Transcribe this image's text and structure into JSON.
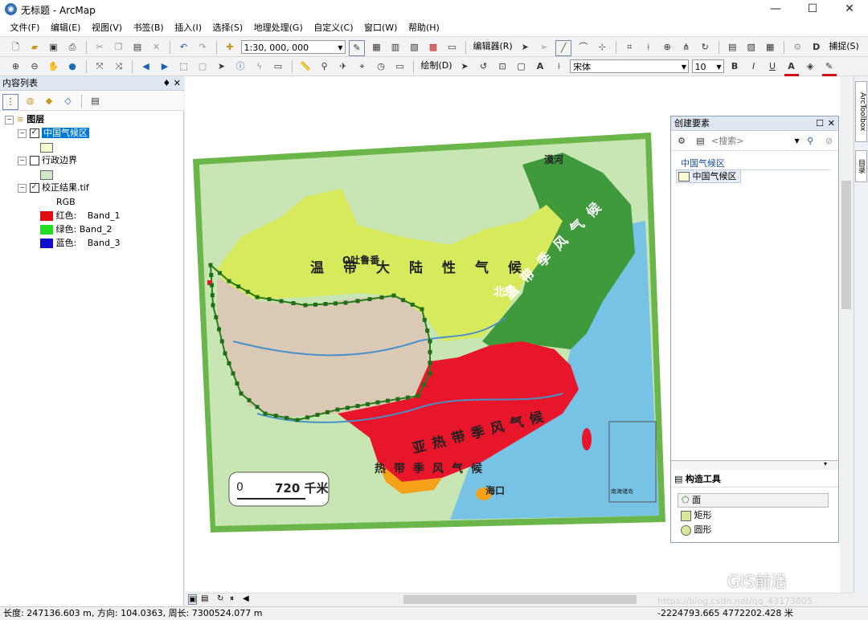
{
  "window": {
    "title": "无标题 - ArcMap",
    "minimize": "—",
    "maximize": "☐",
    "close": "✕"
  },
  "menu": [
    "文件(F)",
    "编辑(E)",
    "视图(V)",
    "书签(B)",
    "插入(I)",
    "选择(S)",
    "地理处理(G)",
    "自定义(C)",
    "窗口(W)",
    "帮助(H)"
  ],
  "toolbar": {
    "scale": "1:30, 000, 000",
    "editor_label": "编辑器(R)",
    "snapping_label": "捕捉(S)",
    "draw_label": "绘制(D)",
    "font_name": "宋体",
    "font_size": "10",
    "bold": "B",
    "italic": "I",
    "underline": "U"
  },
  "toc": {
    "title": "内容列表",
    "pin": "♦ ✕",
    "layers_root": "图层",
    "layer1": "中国气候区",
    "layer2": "行政边界",
    "layer3": "校正结果.tif",
    "rgb_label": "RGB",
    "bands": [
      {
        "label": "红色:",
        "band": "Band_1",
        "color": "#e01010"
      },
      {
        "label": "绿色: Band_2",
        "band": "",
        "color": "#22dd22"
      },
      {
        "label": "蓝色:",
        "band": "Band_3",
        "color": "#1010cc"
      }
    ],
    "layer1_color": "#fafad2",
    "layer2_color": "#cfe8c8"
  },
  "map_labels": {
    "temperate_continental": [
      "温",
      "带",
      "大",
      "陆",
      "性",
      "气",
      "候"
    ],
    "temperate_monsoon": [
      "温",
      "带",
      "季",
      "风",
      "气",
      "候"
    ],
    "subtropical_monsoon": [
      "亚",
      "热",
      "带",
      "季",
      "风",
      "气",
      "候"
    ],
    "tropical_monsoon": [
      "热",
      "带",
      "季",
      "风",
      "气",
      "候"
    ],
    "beijing": "北京",
    "turpan": "O吐鲁番",
    "mohe": "漠河",
    "haikou": "海口",
    "scale_zero": "0",
    "scale_value": "720 千米",
    "nanhai": "南海诸岛"
  },
  "create_features": {
    "title": "创建要素",
    "search_placeholder": "<搜索>",
    "group_label": "中国气候区",
    "template_label": "中国气候区",
    "construct_title": "构造工具",
    "tools": [
      "面",
      "矩形",
      "圆形"
    ]
  },
  "right_tabs": [
    "ArcToolbox",
    "目录"
  ],
  "status": {
    "left": "长度: 247136.603 m, 方向: 104.0363, 周长: 7300524.077 m",
    "coords": "-2224793.665  4772202.428 米"
  },
  "watermark": {
    "brand": "GIS前沿",
    "url": "https://blog.csdn.net/qq_43173805"
  },
  "colors": {
    "temperate_continental": "#d7ea5c",
    "temperate_monsoon": "#3f9a3c",
    "subtropical": "#e8162b",
    "tropical": "#f5a21a",
    "plateau": "#d9c9b5",
    "sea": "#76c3e6",
    "land_bg": "#c8e6b4",
    "frame": "#6ab64a",
    "selection": "#0078d7"
  }
}
